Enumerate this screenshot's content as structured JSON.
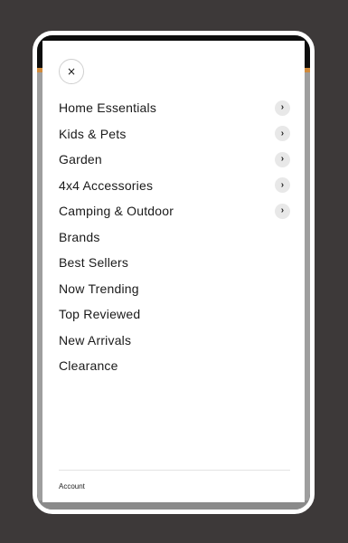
{
  "close_button": {
    "icon": "×"
  },
  "menu": {
    "items": [
      {
        "label": "Home Essentials",
        "has_chevron": true,
        "chevron": "›"
      },
      {
        "label": "Kids & Pets",
        "has_chevron": true,
        "chevron": "›"
      },
      {
        "label": "Garden",
        "has_chevron": true,
        "chevron": "›"
      },
      {
        "label": "4x4 Accessories",
        "has_chevron": true,
        "chevron": "›"
      },
      {
        "label": "Camping & Outdoor",
        "has_chevron": true,
        "chevron": "›"
      },
      {
        "label": "Brands",
        "has_chevron": false
      },
      {
        "label": "Best Sellers",
        "has_chevron": false
      },
      {
        "label": "Now Trending",
        "has_chevron": false
      },
      {
        "label": "Top Reviewed",
        "has_chevron": false
      },
      {
        "label": "New Arrivals",
        "has_chevron": false
      },
      {
        "label": "Clearance",
        "has_chevron": false
      }
    ]
  },
  "footer": {
    "account_label": "Account"
  },
  "colors": {
    "page_bg": "#3d3939",
    "drawer_bg": "#ffffff",
    "accent": "#d08a3c",
    "text": "#1a1a1a"
  }
}
